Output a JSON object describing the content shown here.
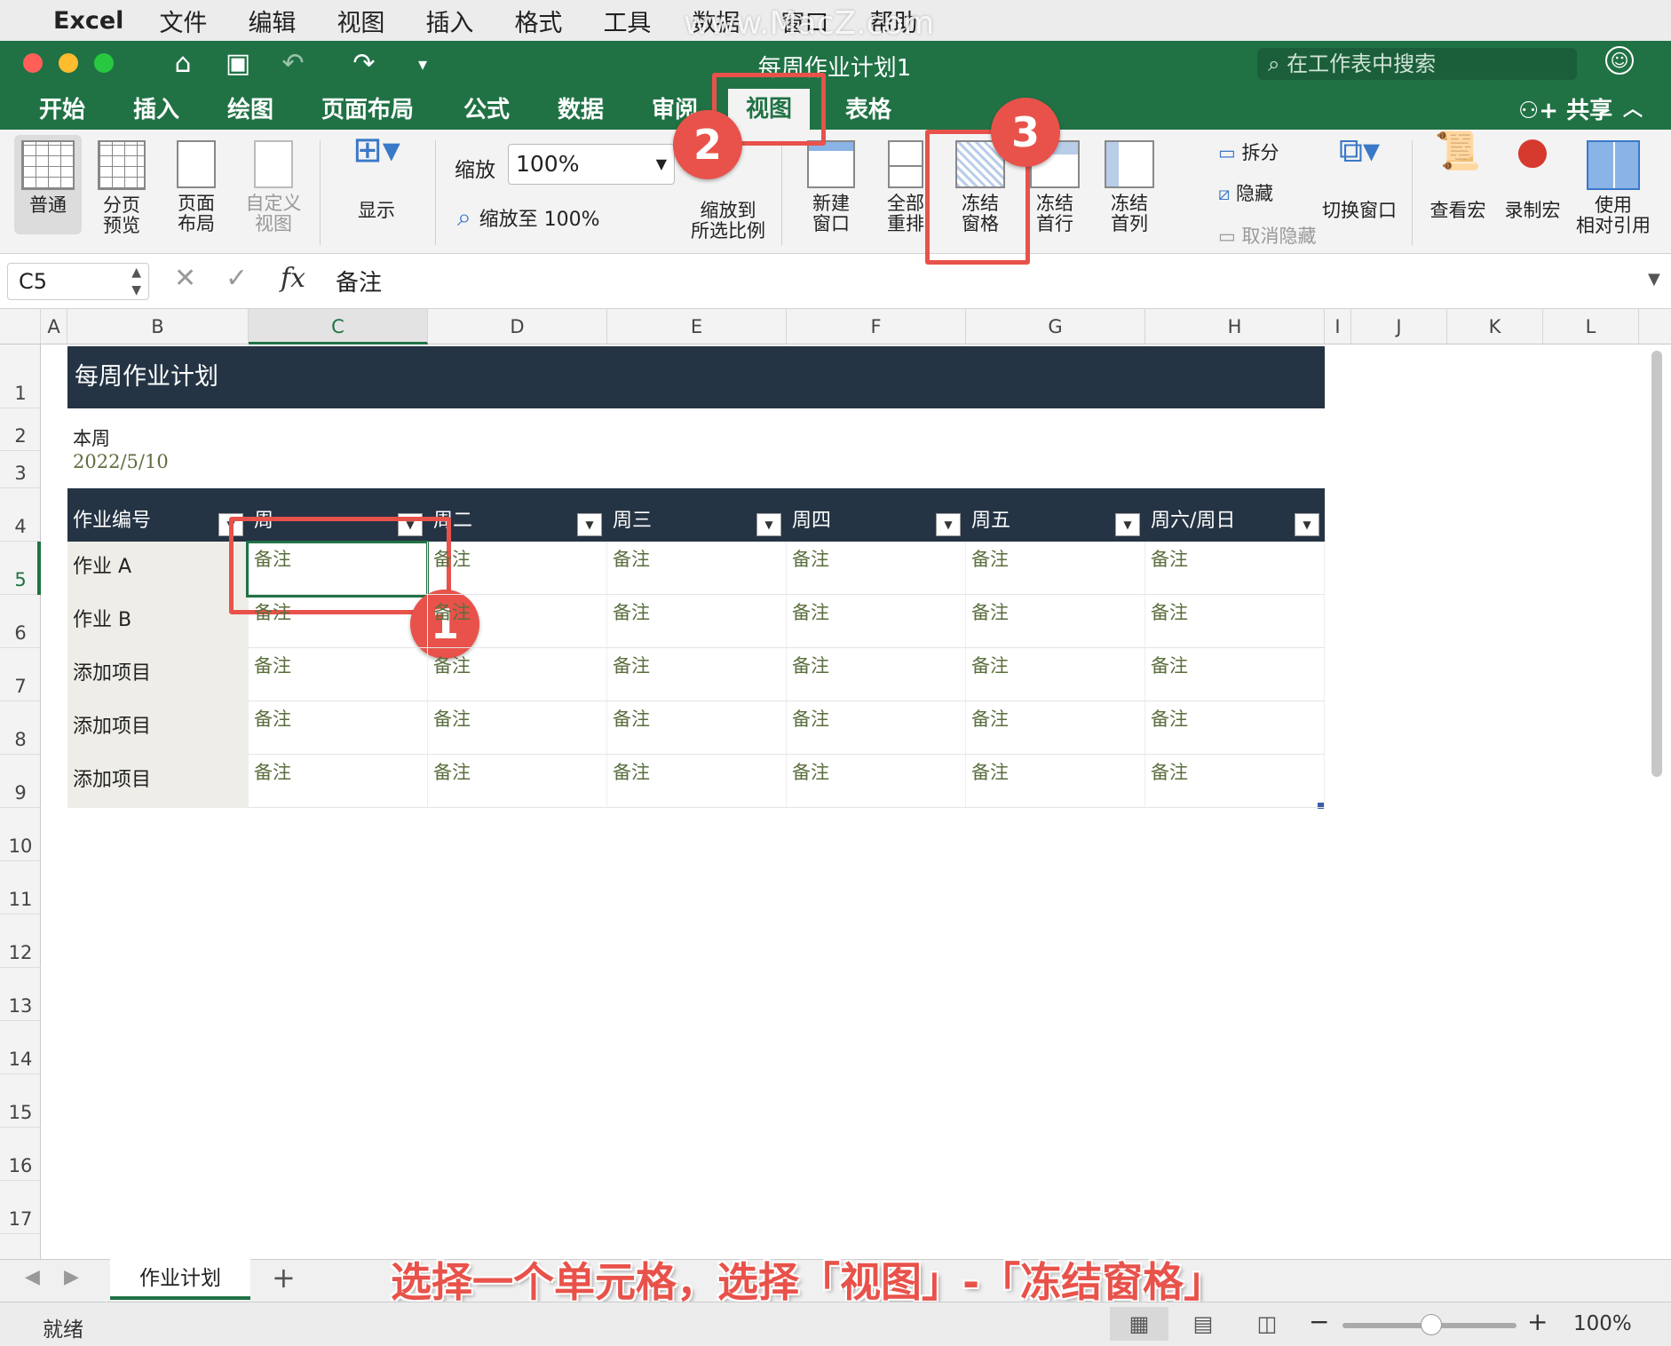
{
  "macmenu": {
    "app": "Excel",
    "items": [
      "文件",
      "编辑",
      "视图",
      "插入",
      "格式",
      "工具",
      "数据",
      "窗口",
      "帮助"
    ]
  },
  "watermark": "www.MacZ.com",
  "window": {
    "title": "每周作业计划1",
    "search_placeholder": "在工作表中搜索"
  },
  "tabs": [
    "开始",
    "插入",
    "绘图",
    "页面布局",
    "公式",
    "数据",
    "审阅",
    "视图",
    "表格"
  ],
  "share": "共享",
  "ribbon": {
    "normal": "普通",
    "pagebreak": "分页\n预览",
    "pagelayout": "页面\n布局",
    "custom": "自定义\n视图",
    "show": "显示",
    "zoom_label": "缩放",
    "zoom_value": "100%",
    "zoom100": "缩放至 100%",
    "zoomsel": "缩放到\n所选比例",
    "newwin": "新建\n窗口",
    "arrange": "全部\n重排",
    "freeze": "冻结\n窗格",
    "freezerow": "冻结\n首行",
    "freezecol": "冻结\n首列",
    "split": "拆分",
    "hide": "隐藏",
    "unhide": "取消隐藏",
    "switch": "切换窗口",
    "viewmacro": "查看宏",
    "recmacro": "录制宏",
    "relref": "使用\n相对引用"
  },
  "formula": {
    "namebox": "C5",
    "value": "备注"
  },
  "columns": [
    "A",
    "B",
    "C",
    "D",
    "E",
    "F",
    "G",
    "H",
    "I",
    "J",
    "K",
    "L"
  ],
  "rows": [
    "1",
    "2",
    "3",
    "4",
    "5",
    "6",
    "7",
    "8",
    "9",
    "10",
    "11",
    "12",
    "13",
    "14",
    "15",
    "16",
    "17"
  ],
  "sheet": {
    "title": "每周作业计划",
    "week_label": "本周",
    "week_date": "2022/5/10",
    "headers": [
      "作业编号",
      "周一",
      "周二",
      "周三",
      "周四",
      "周五",
      "周六/周日"
    ],
    "row_labels": [
      "作业 A",
      "作业 B",
      "添加项目",
      "添加项目",
      "添加项目"
    ],
    "cell_text": "备注"
  },
  "annotations": {
    "badges": [
      "1",
      "2",
      "3"
    ],
    "caption": "选择一个单元格，选择「视图」-「冻结窗格」"
  },
  "sheettab": "作业计划",
  "status": {
    "ready": "就绪",
    "zoom": "100%"
  },
  "colors": {
    "excel_green": "#207245",
    "dark_band": "#253444",
    "callout_red": "#e8524a"
  }
}
